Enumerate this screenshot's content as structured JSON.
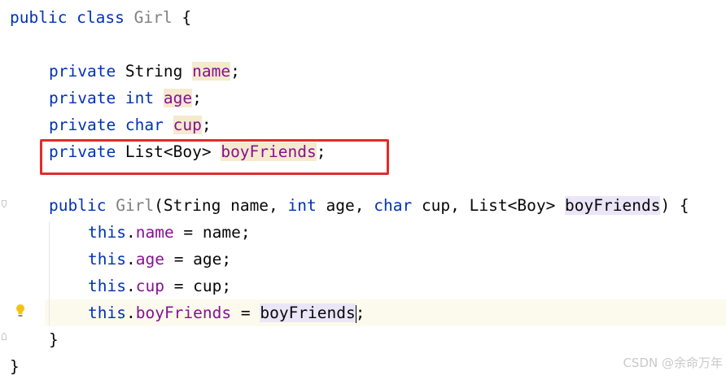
{
  "editor": {
    "language": "java",
    "colors": {
      "keyword": "#0033b3",
      "field": "#871094",
      "unused_class": "#808080",
      "usage_highlight": "#f5eacd",
      "param_highlight": "#ebe6f7",
      "annotation_box": "#e32b2b",
      "current_line": "#fcfaed"
    },
    "lines": [
      {
        "kw": "public class",
        "name": "Girl",
        "tail": " {"
      },
      {
        "kw": "private",
        "type": " String ",
        "name": "name",
        "tail": ";"
      },
      {
        "kw": "private int",
        "name": "age",
        "tail": ";"
      },
      {
        "kw": "private char",
        "name": "cup",
        "tail": ";"
      },
      {
        "kw": "private",
        "type": " List<Boy> ",
        "name": "boyFriends",
        "tail": ";"
      },
      {
        "kw": "public",
        "name": "Girl",
        "p1": "(String name, ",
        "kw2": "int",
        "p2": " age, ",
        "kw3": "char",
        "p3": " cup, List<Boy> ",
        "pname": "boyFriends",
        "tail": ") {"
      },
      {
        "kw": "this",
        "dot": ".",
        "field": "name",
        "tail": " = name;"
      },
      {
        "kw": "this",
        "dot": ".",
        "field": "age",
        "tail": " = age;"
      },
      {
        "kw": "this",
        "dot": ".",
        "field": "cup",
        "tail": " = cup;"
      },
      {
        "kw": "this",
        "dot": ".",
        "field": "boyFriends",
        "eq": " = ",
        "val": "boyFriends",
        "tail": ";"
      },
      {
        "text": "}"
      },
      {
        "text": "}"
      }
    ],
    "gutter_icon": "lightbulb-icon",
    "highlighted_line_index": 4
  },
  "watermark": "CSDN @余命万年"
}
